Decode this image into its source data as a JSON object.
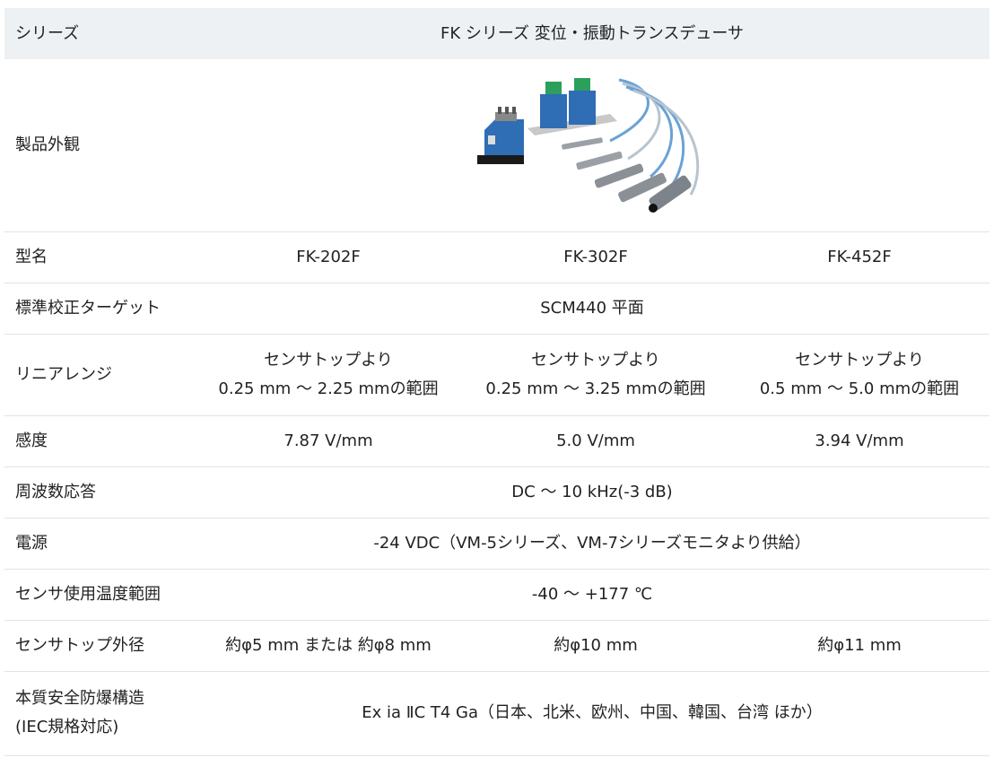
{
  "table": {
    "header": {
      "label": "シリーズ",
      "title": "FK シリーズ 変位・振動トランスデューサ"
    },
    "appearance_label": "製品外観",
    "rows": {
      "model": {
        "label": "型名",
        "values": [
          "FK-202F",
          "FK-302F",
          "FK-452F"
        ]
      },
      "target": {
        "label": "標準校正ターゲット",
        "value": "SCM440 平面"
      },
      "range": {
        "label": "リニアレンジ",
        "values": [
          {
            "line1": "センサトップより",
            "line2": "0.25 mm ～ 2.25 mmの範囲"
          },
          {
            "line1": "センサトップより",
            "line2": "0.25 mm ～ 3.25 mmの範囲"
          },
          {
            "line1": "センサトップより",
            "line2": "0.5 mm ～ 5.0 mmの範囲"
          }
        ]
      },
      "sensitivity": {
        "label": "感度",
        "values": [
          "7.87 V/mm",
          "5.0 V/mm",
          "3.94 V/mm"
        ]
      },
      "frequency": {
        "label": "周波数応答",
        "value": "DC ～ 10 kHz(-3 dB)"
      },
      "power": {
        "label": "電源",
        "value": "-24 VDC（VM-5シリーズ、VM-7シリーズモニタより供給）"
      },
      "temperature": {
        "label": "センサ使用温度範囲",
        "value": "-40 ～ +177 ℃"
      },
      "diameter": {
        "label": "センサトップ外径",
        "values": [
          "約φ5 mm または 約φ8 mm",
          "約φ10 mm",
          "約φ11 mm"
        ]
      },
      "explosion": {
        "label_line1": "本質安全防爆構造",
        "label_line2": "(IEC規格対応)",
        "value": "Ex ia ⅡC T4 Ga（日本、北米、欧州、中国、韓国、台湾 ほか）"
      }
    }
  },
  "colors": {
    "header_bg": "#eef1f4",
    "border": "#e3e3e3",
    "device_blue": "#2f6db5",
    "cable_blue": "#6aa2d6"
  }
}
